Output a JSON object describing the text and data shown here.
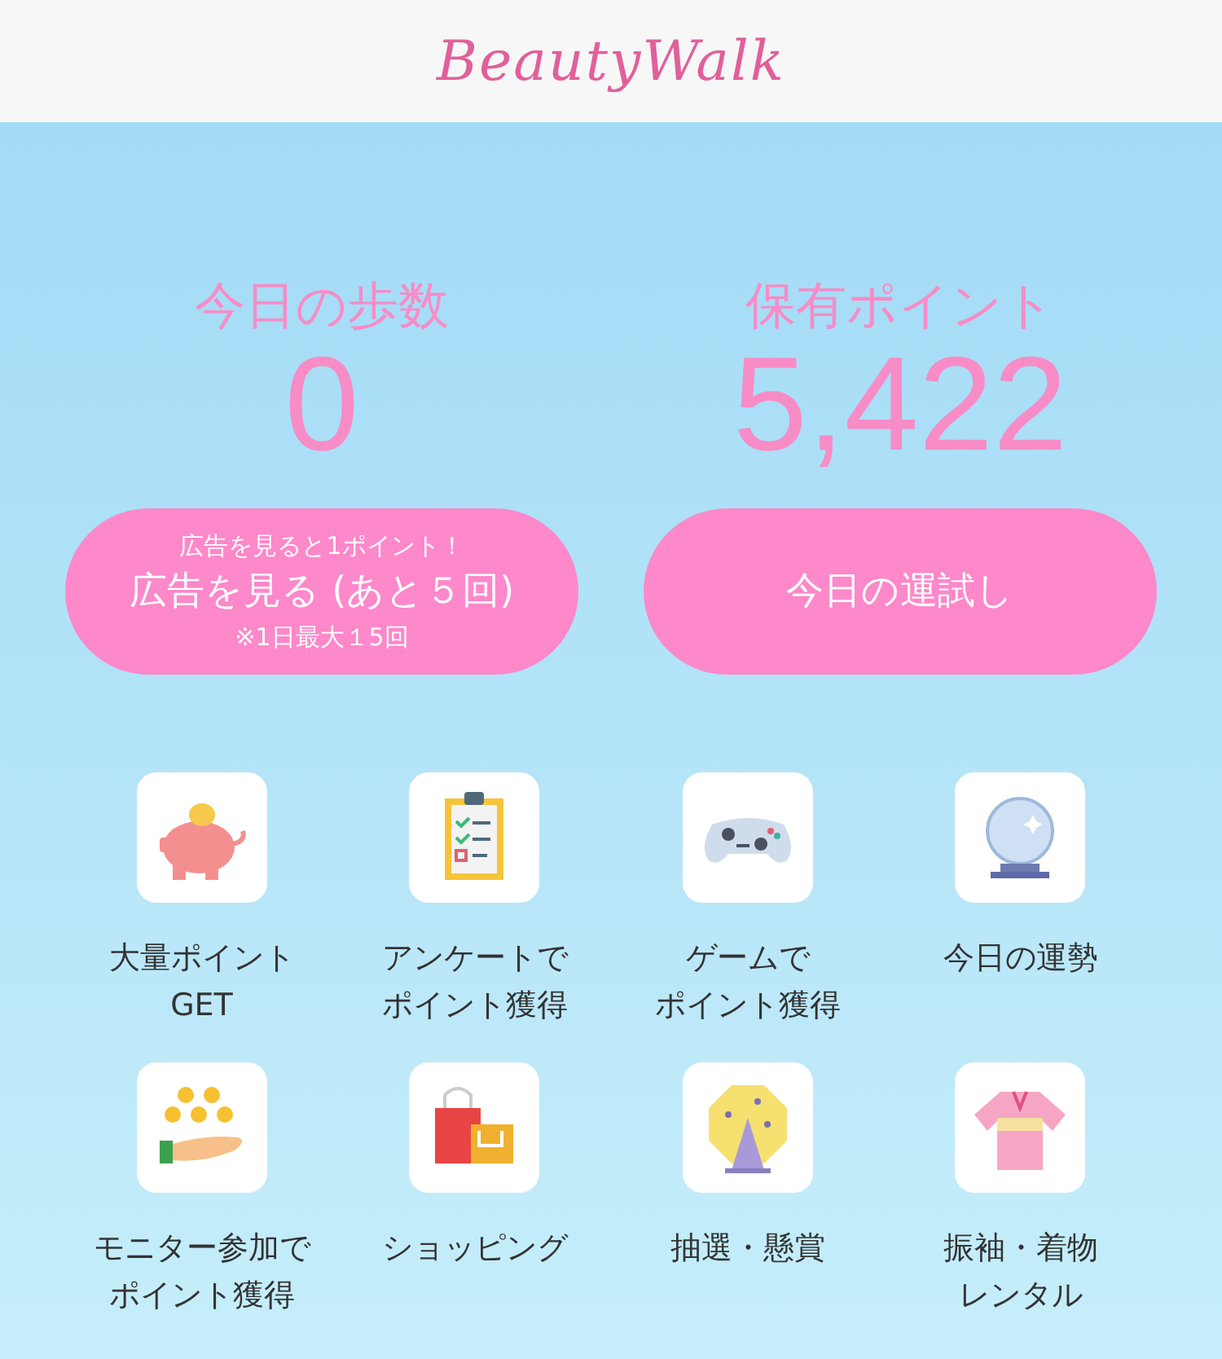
{
  "header": {
    "logo": "BeautyWalk"
  },
  "stats": [
    {
      "label": "今日の歩数",
      "value": "0"
    },
    {
      "label": "保有ポイント",
      "value": "5,422"
    }
  ],
  "buttons": [
    {
      "kind": "ad",
      "top": "広告を見ると1ポイント！",
      "main": "広告を見る (あと５回)",
      "note": "※1日最大１5回"
    },
    {
      "kind": "plain",
      "main": "今日の運試し"
    }
  ],
  "menu": [
    {
      "lines": [
        "大量ポイント",
        "GET"
      ]
    },
    {
      "lines": [
        "アンケートで",
        "ポイント獲得"
      ]
    },
    {
      "lines": [
        "ゲームで",
        "ポイント獲得"
      ]
    },
    {
      "lines": [
        "今日の運勢"
      ]
    },
    {
      "lines": [
        "モニター参加で",
        "ポイント獲得"
      ]
    },
    {
      "lines": [
        "ショッピング"
      ]
    },
    {
      "lines": [
        "抽選・懸賞"
      ]
    },
    {
      "lines": [
        "振袖・着物",
        "レンタル"
      ]
    }
  ]
}
